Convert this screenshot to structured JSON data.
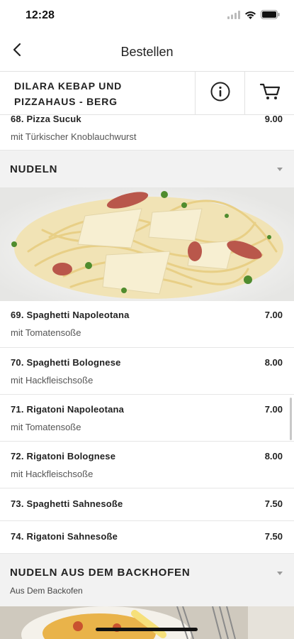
{
  "status_bar": {
    "time": "12:28"
  },
  "nav": {
    "title": "Bestellen",
    "back_icon": "chevron-left-icon"
  },
  "restaurant": {
    "name_line1": "DILARA KEBAP UND",
    "name_line2": "PIZZAHAUS - BERG",
    "info_icon": "info-icon",
    "cart_icon": "cart-icon"
  },
  "menu": {
    "item_68": {
      "name": "68. Pizza Sucuk",
      "price": "9.00",
      "description": "mit Türkischer Knoblauchwurst"
    },
    "category_nudeln": {
      "title": "NUDELN"
    },
    "items": [
      {
        "name": "69. Spaghetti Napoleotana",
        "price": "7.00",
        "description": "mit Tomatensoße"
      },
      {
        "name": "70. Spaghetti Bolognese",
        "price": "8.00",
        "description": "mit Hackfleischsoße"
      },
      {
        "name": "71. Rigatoni Napoleotana",
        "price": "7.00",
        "description": "mit Tomatensoße"
      },
      {
        "name": "72. Rigatoni Bolognese",
        "price": "8.00",
        "description": "mit Hackfleischsoße"
      },
      {
        "name": "73. Spaghetti Sahnesoße",
        "price": "7.50"
      },
      {
        "name": "74. Rigatoni Sahnesoße",
        "price": "7.50"
      }
    ],
    "category_backofen": {
      "title": "NUDELN AUS DEM BACKHOFEN",
      "subtitle": "Aus Dem Backofen"
    }
  },
  "colors": {
    "accent": "#222222",
    "divider": "#e2e2e2",
    "category_bg": "#f2f2f2"
  }
}
